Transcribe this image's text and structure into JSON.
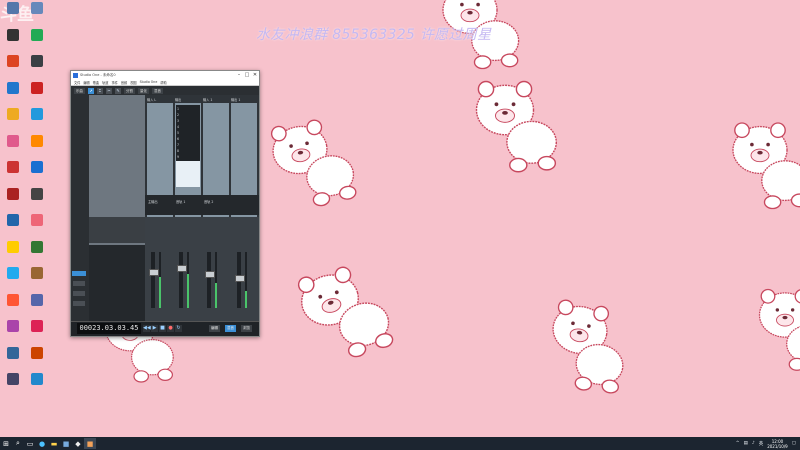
{
  "overlay": {
    "text": "水友冲浪群 855363325 许愿过周星"
  },
  "logo": {
    "text": "斗鱼"
  },
  "desktop_icons": [
    {
      "label": "",
      "color": "#5577aa"
    },
    {
      "label": "",
      "color": "#6688bb"
    },
    {
      "label": "",
      "color": "#333333"
    },
    {
      "label": "",
      "color": "#22aa55"
    },
    {
      "label": "",
      "color": "#dd4422"
    },
    {
      "label": "",
      "color": "#3a3f44"
    },
    {
      "label": "",
      "color": "#2277cc"
    },
    {
      "label": "",
      "color": "#cc2222"
    },
    {
      "label": "",
      "color": "#eeaa22"
    },
    {
      "label": "",
      "color": "#2299dd"
    },
    {
      "label": "",
      "color": "#e05a8c"
    },
    {
      "label": "",
      "color": "#ff8800"
    },
    {
      "label": "",
      "color": "#cc3333"
    },
    {
      "label": "",
      "color": "#1a6fd1"
    },
    {
      "label": "",
      "color": "#aa2222"
    },
    {
      "label": "",
      "color": "#444444"
    },
    {
      "label": "",
      "color": "#2266aa"
    },
    {
      "label": "",
      "color": "#ee6677"
    },
    {
      "label": "",
      "color": "#ffcc00"
    },
    {
      "label": "",
      "color": "#337733"
    },
    {
      "label": "",
      "color": "#22aaee"
    },
    {
      "label": "",
      "color": "#996633"
    },
    {
      "label": "",
      "color": "#ff5533"
    },
    {
      "label": "",
      "color": "#5566aa"
    },
    {
      "label": "",
      "color": "#aa44aa"
    },
    {
      "label": "",
      "color": "#dd2255"
    },
    {
      "label": "",
      "color": "#336699"
    },
    {
      "label": "",
      "color": "#cc4400"
    },
    {
      "label": "",
      "color": "#444466"
    },
    {
      "label": "",
      "color": "#2288cc"
    }
  ],
  "window": {
    "title": "Studio One - 未命名0",
    "menu": [
      "文件",
      "编辑",
      "歌曲",
      "轨道",
      "事件",
      "音频",
      "视图",
      "Studio One",
      "帮助"
    ],
    "toolbar": {
      "track_label": "乐曲",
      "edit": "分割",
      "snap": "量化",
      "mix": "混音"
    },
    "mixer_header": [
      "输入 L",
      "输出",
      "输入 1",
      "输出 1"
    ],
    "sends_list": [
      "1",
      "2",
      "3",
      "4",
      "5",
      "6",
      "7",
      "8",
      "9"
    ],
    "channel_names": [
      "",
      "",
      "",
      "",
      ""
    ],
    "mix_labels": [
      "主输出",
      "音轨 1",
      "音轨 2"
    ],
    "timecode": "00023.03.03.45",
    "bottom_buttons": [
      "编辑",
      "混音",
      "浏览"
    ]
  },
  "taskbar": {
    "start_icon": "windows-start-icon",
    "clock_time": "12:00",
    "clock_date": "2021/10/9",
    "tray_text": "英"
  },
  "colors": {
    "wallpaper": "#f7c2cc",
    "bear": "#ffffff",
    "bear_outline": "#c7485e",
    "taskbar": "#1c2530",
    "accent": "#3b8fd6"
  }
}
